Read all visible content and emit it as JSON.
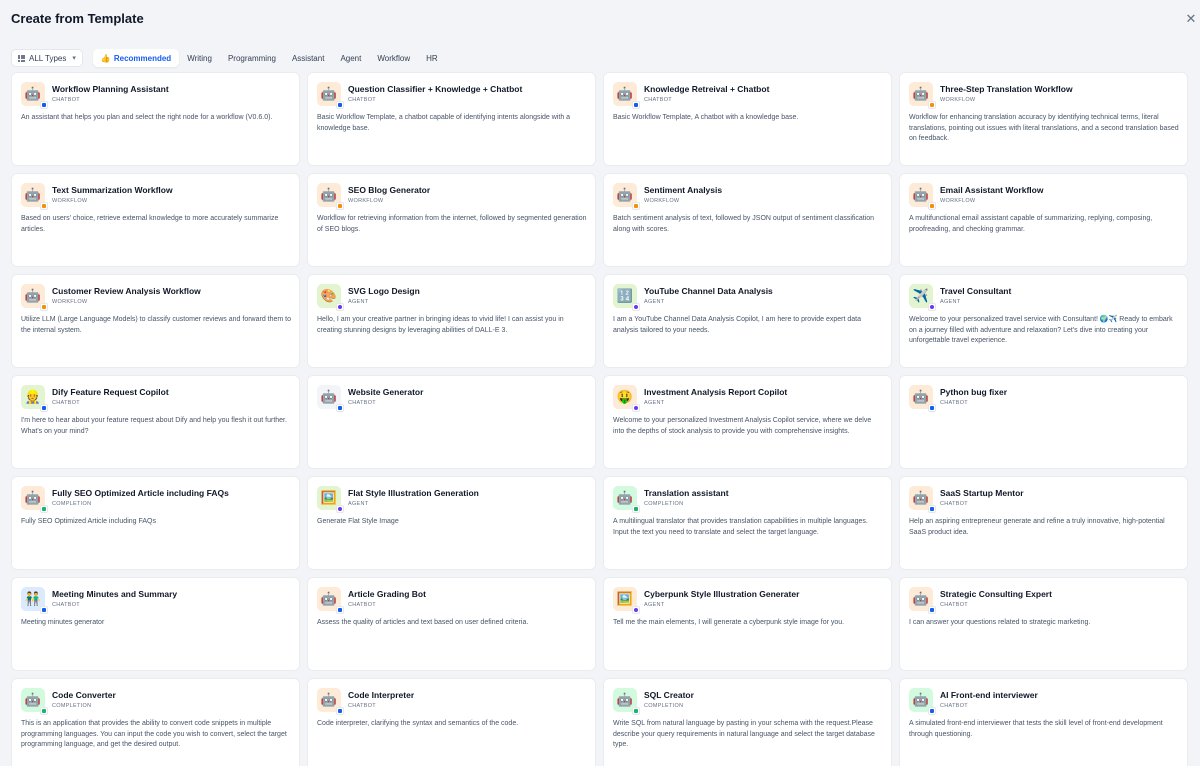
{
  "header": {
    "title": "Create from Template",
    "close_icon": "close-icon"
  },
  "filters": {
    "type_select": "ALL Types",
    "tabs": [
      "Recommended",
      "Writing",
      "Programming",
      "Assistant",
      "Agent",
      "Workflow",
      "HR"
    ],
    "active_tab": "Recommended"
  },
  "colors": {
    "accent": "#155eef",
    "background": "#f2f4f7",
    "card_bg": "#ffffff"
  },
  "templates": [
    {
      "name": "Workflow Planning Assistant",
      "type": "CHATBOT",
      "icon": "🤖",
      "icon_bg": "#fdead7",
      "desc": "An assistant that helps you plan and select the right node for a workflow (V0.6.0)."
    },
    {
      "name": "Question Classifier + Knowledge + Chatbot",
      "type": "CHATBOT",
      "icon": "🤖",
      "icon_bg": "#fdead7",
      "desc": "Basic Workflow Template, a chatbot capable of identifying intents alongside with a knowledge base."
    },
    {
      "name": "Knowledge Retreival + Chatbot",
      "type": "CHATBOT",
      "icon": "🤖",
      "icon_bg": "#fdead7",
      "desc": "Basic Workflow Template, A chatbot with a knowledge base."
    },
    {
      "name": "Three-Step Translation Workflow",
      "type": "WORKFLOW",
      "icon": "🤖",
      "icon_bg": "#fdead7",
      "desc": "Workflow for enhancing translation accuracy by identifying technical terms, literal translations, pointing out issues with literal translations, and a second translation based on feedback."
    },
    {
      "name": "Text Summarization Workflow",
      "type": "WORKFLOW",
      "icon": "🤖",
      "icon_bg": "#fdead7",
      "desc": "Based on users' choice, retrieve external knowledge to more accurately summarize articles."
    },
    {
      "name": "SEO Blog Generator",
      "type": "WORKFLOW",
      "icon": "🤖",
      "icon_bg": "#fdead7",
      "desc": "Workflow for retrieving information from the internet, followed by segmented generation of SEO blogs."
    },
    {
      "name": "Sentiment Analysis",
      "type": "WORKFLOW",
      "icon": "🤖",
      "icon_bg": "#fdead7",
      "desc": "Batch sentiment analysis of text, followed by JSON output of sentiment classification along with scores."
    },
    {
      "name": "Email Assistant Workflow",
      "type": "WORKFLOW",
      "icon": "🤖",
      "icon_bg": "#fdead7",
      "desc": "A multifunctional email assistant capable of summarizing, replying, composing, proofreading, and checking grammar."
    },
    {
      "name": "Customer Review Analysis Workflow",
      "type": "WORKFLOW",
      "icon": "🤖",
      "icon_bg": "#fdead7",
      "desc": "Utilize LLM (Large Language Models) to classify customer reviews and forward them to the internal system."
    },
    {
      "name": "SVG Logo Design",
      "type": "AGENT",
      "icon": "🎨",
      "icon_bg": "#e3f4d0",
      "desc": "Hello, I am your creative partner in bringing ideas to vivid life! I can assist you in creating stunning designs by leveraging abilities of DALL-E 3."
    },
    {
      "name": "YouTube Channel Data Analysis",
      "type": "AGENT",
      "icon": "🔢",
      "icon_bg": "#e3f4d0",
      "desc": "I am a YouTube Channel Data Analysis Copilot, I am here to provide expert data analysis tailored to your needs."
    },
    {
      "name": "Travel Consultant",
      "type": "AGENT",
      "icon": "✈️",
      "icon_bg": "#e3f4d0",
      "desc": "Welcome to your personalized travel service with Consultant! 🌍✈️ Ready to embark on a journey filled with adventure and relaxation? Let's dive into creating your unforgettable travel experience."
    },
    {
      "name": "Dify Feature Request Copilot",
      "type": "CHATBOT",
      "icon": "👷",
      "icon_bg": "#e3f4d0",
      "desc": "I'm here to hear about your feature request about Dify and help you flesh it out further. What's on your mind?"
    },
    {
      "name": "Website Generator",
      "type": "CHATBOT",
      "icon": "🤖",
      "icon_bg": "#f2f4f7",
      "desc": ""
    },
    {
      "name": "Investment Analysis Report Copilot",
      "type": "AGENT",
      "icon": "🤑",
      "icon_bg": "#fdead7",
      "desc": "Welcome to your personalized Investment Analysis Copilot service, where we delve into the depths of stock analysis to provide you with comprehensive insights."
    },
    {
      "name": "Python bug fixer",
      "type": "CHATBOT",
      "icon": "🤖",
      "icon_bg": "#fdead7",
      "desc": ""
    },
    {
      "name": "Fully SEO Optimized Article including FAQs",
      "type": "COMPLETION",
      "icon": "🤖",
      "icon_bg": "#fdead7",
      "desc": "Fully SEO Optimized Article including FAQs"
    },
    {
      "name": "Flat Style Illustration Generation",
      "type": "AGENT",
      "icon": "🖼️",
      "icon_bg": "#e3f4d0",
      "desc": "Generate Flat Style Image"
    },
    {
      "name": "Translation assistant",
      "type": "COMPLETION",
      "icon": "🤖",
      "icon_bg": "#d1fadf",
      "desc": "A multilingual translator that provides translation capabilities in multiple languages. Input the text you need to translate and select the target language."
    },
    {
      "name": "SaaS Startup Mentor",
      "type": "CHATBOT",
      "icon": "🤖",
      "icon_bg": "#fdead7",
      "desc": "Help an aspiring entrepreneur generate and refine a truly innovative, high-potential SaaS product idea."
    },
    {
      "name": "Meeting Minutes and Summary",
      "type": "CHATBOT",
      "icon": "👬",
      "icon_bg": "#dbeafe",
      "desc": "Meeting minutes generator"
    },
    {
      "name": "Article Grading Bot",
      "type": "CHATBOT",
      "icon": "🤖",
      "icon_bg": "#fdead7",
      "desc": "Assess the quality of articles and text based on user defined criteria."
    },
    {
      "name": "Cyberpunk Style Illustration Generater",
      "type": "AGENT",
      "icon": "🖼️",
      "icon_bg": "#fdead7",
      "desc": "Tell me the main elements, I will generate a cyberpunk style image for you."
    },
    {
      "name": "Strategic Consulting Expert",
      "type": "CHATBOT",
      "icon": "🤖",
      "icon_bg": "#fdead7",
      "desc": "I can answer your questions related to strategic marketing."
    },
    {
      "name": "Code Converter",
      "type": "COMPLETION",
      "icon": "🤖",
      "icon_bg": "#d1fadf",
      "desc": "This is an application that provides the ability to convert code snippets in multiple programming languages. You can input the code you wish to convert, select the target programming language, and get the desired output."
    },
    {
      "name": "Code Interpreter",
      "type": "CHATBOT",
      "icon": "🤖",
      "icon_bg": "#fdead7",
      "desc": "Code interpreter, clarifying the syntax and semantics of the code."
    },
    {
      "name": "SQL Creator",
      "type": "COMPLETION",
      "icon": "🤖",
      "icon_bg": "#d1fadf",
      "desc": "Write SQL from natural language by pasting in your schema with the request.Please describe your query requirements in natural language and select the target database type."
    },
    {
      "name": "AI Front-end interviewer",
      "type": "CHATBOT",
      "icon": "🤖",
      "icon_bg": "#d1fadf",
      "desc": "A simulated front-end interviewer that tests the skill level of front-end development through questioning."
    }
  ]
}
